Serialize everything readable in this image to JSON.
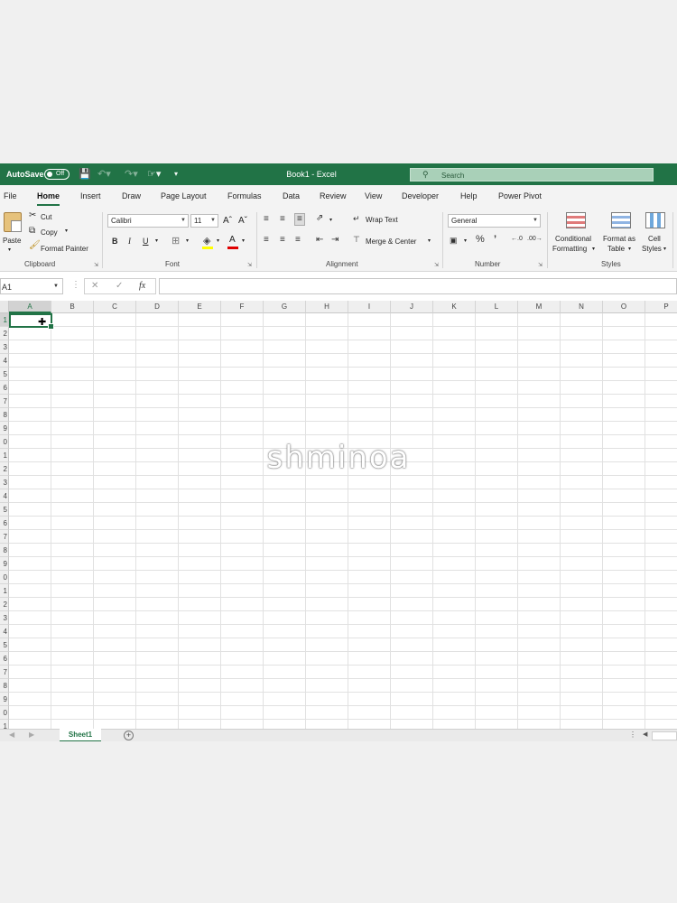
{
  "titlebar": {
    "autosave_label": "AutoSave",
    "autosave_state": "Off",
    "title": "Book1  -  Excel",
    "search_placeholder": "Search"
  },
  "ribbon_tabs": [
    "File",
    "Home",
    "Insert",
    "Draw",
    "Page Layout",
    "Formulas",
    "Data",
    "Review",
    "View",
    "Developer",
    "Help",
    "Power Pivot"
  ],
  "active_tab": "Home",
  "clipboard": {
    "paste": "Paste",
    "cut": "Cut",
    "copy": "Copy",
    "format_painter": "Format Painter",
    "label": "Clipboard"
  },
  "font": {
    "family": "Calibri",
    "size": "11",
    "label": "Font"
  },
  "alignment": {
    "wrap_text": "Wrap Text",
    "merge_center": "Merge & Center",
    "label": "Alignment"
  },
  "number": {
    "format": "General",
    "label": "Number"
  },
  "styles": {
    "conditional_1": "Conditional",
    "conditional_2": "Formatting",
    "format_table_1": "Format as",
    "format_table_2": "Table",
    "cell_styles_1": "Cell",
    "cell_styles_2": "Styles",
    "label": "Styles"
  },
  "formula_bar": {
    "name_box": "A1",
    "fx": "fx",
    "value": ""
  },
  "columns": [
    "A",
    "B",
    "C",
    "D",
    "E",
    "F",
    "G",
    "H",
    "I",
    "J",
    "K",
    "L",
    "M",
    "N",
    "O",
    "P"
  ],
  "rows": [
    "1",
    "2",
    "3",
    "4",
    "5",
    "6",
    "7",
    "8",
    "9",
    "0",
    "1",
    "2",
    "3",
    "4",
    "5",
    "6",
    "7",
    "8",
    "9",
    "0",
    "1",
    "2",
    "3",
    "4",
    "5",
    "6",
    "7",
    "8",
    "9",
    "0",
    "1"
  ],
  "sheets": {
    "active": "Sheet1",
    "add": "+"
  },
  "watermark": "shminoa",
  "colors": {
    "excel_green": "#217346",
    "ribbon_bg": "#f3f3f3"
  }
}
